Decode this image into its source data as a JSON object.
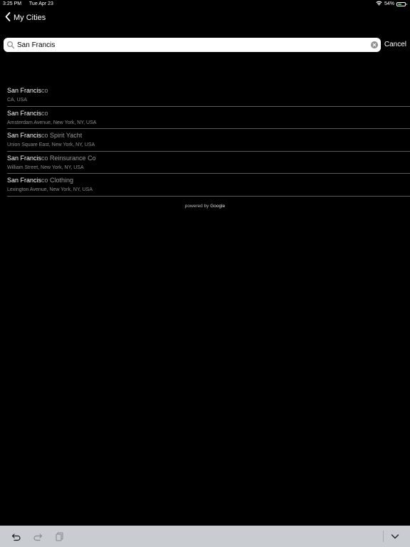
{
  "status_bar": {
    "time": "3:25 PM",
    "date": "Tue Apr 23",
    "battery_percent": "54%",
    "battery_level": 0.54,
    "battery_color": "#30d158"
  },
  "nav": {
    "back_label": "My Cities",
    "back_icon": "chevron-left-icon"
  },
  "search": {
    "value": "San Francis",
    "placeholder": "",
    "cancel_label": "Cancel",
    "search_icon": "search-icon",
    "clear_icon": "clear-icon"
  },
  "results": [
    {
      "match": "San Francis",
      "rest": "co",
      "subtitle": "CA, USA"
    },
    {
      "match": "San Francis",
      "rest": "co",
      "subtitle": "Amsterdam Avenue, New York, NY, USA"
    },
    {
      "match": "San Francis",
      "rest": "co Spirit Yacht",
      "subtitle": "Union Square East, New York, NY, USA"
    },
    {
      "match": "San Francis",
      "rest": "co Reinsurance Co",
      "subtitle": "William Street, New York, NY, USA"
    },
    {
      "match": "San Francis",
      "rest": "co Clothing",
      "subtitle": "Lexington Avenue, New York, NY, USA"
    }
  ],
  "footer": {
    "powered_by": "powered by ",
    "provider": "Google"
  },
  "toolbar": {
    "undo_icon": "undo-icon",
    "redo_icon": "redo-icon",
    "paste_icon": "clipboard-icon",
    "dismiss_icon": "chevron-down-icon"
  }
}
